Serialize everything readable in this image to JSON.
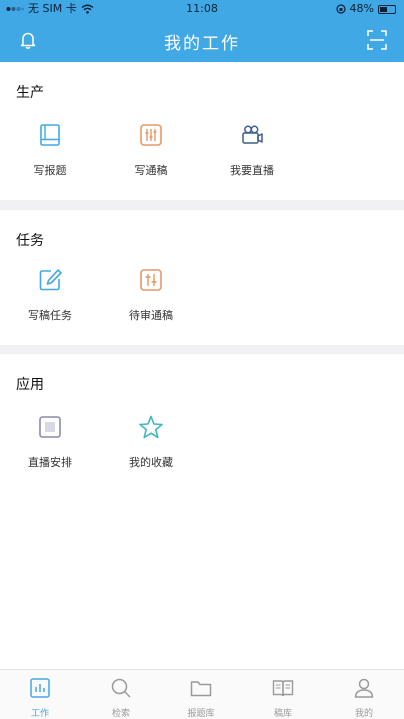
{
  "status_bar": {
    "carrier": "无 SIM 卡",
    "time": "11:08",
    "battery": "48%"
  },
  "header": {
    "title": "我的工作"
  },
  "sections": [
    {
      "title": "生产",
      "items": [
        {
          "label": "写报题",
          "icon": "book-icon"
        },
        {
          "label": "写通稿",
          "icon": "sliders-icon"
        },
        {
          "label": "我要直播",
          "icon": "video-camera-icon"
        }
      ]
    },
    {
      "title": "任务",
      "items": [
        {
          "label": "写稿任务",
          "icon": "edit-icon"
        },
        {
          "label": "待审通稿",
          "icon": "review-icon"
        }
      ]
    },
    {
      "title": "应用",
      "items": [
        {
          "label": "直播安排",
          "icon": "square-icon"
        },
        {
          "label": "我的收藏",
          "icon": "star-icon"
        }
      ]
    }
  ],
  "tabbar": {
    "active": "工作",
    "tabs": [
      {
        "label": "工作"
      },
      {
        "label": "检索"
      },
      {
        "label": "报题库"
      },
      {
        "label": "稿库"
      },
      {
        "label": "我的"
      }
    ]
  },
  "colors": {
    "accent": "#41a8e6",
    "orange": "#e39a67"
  }
}
